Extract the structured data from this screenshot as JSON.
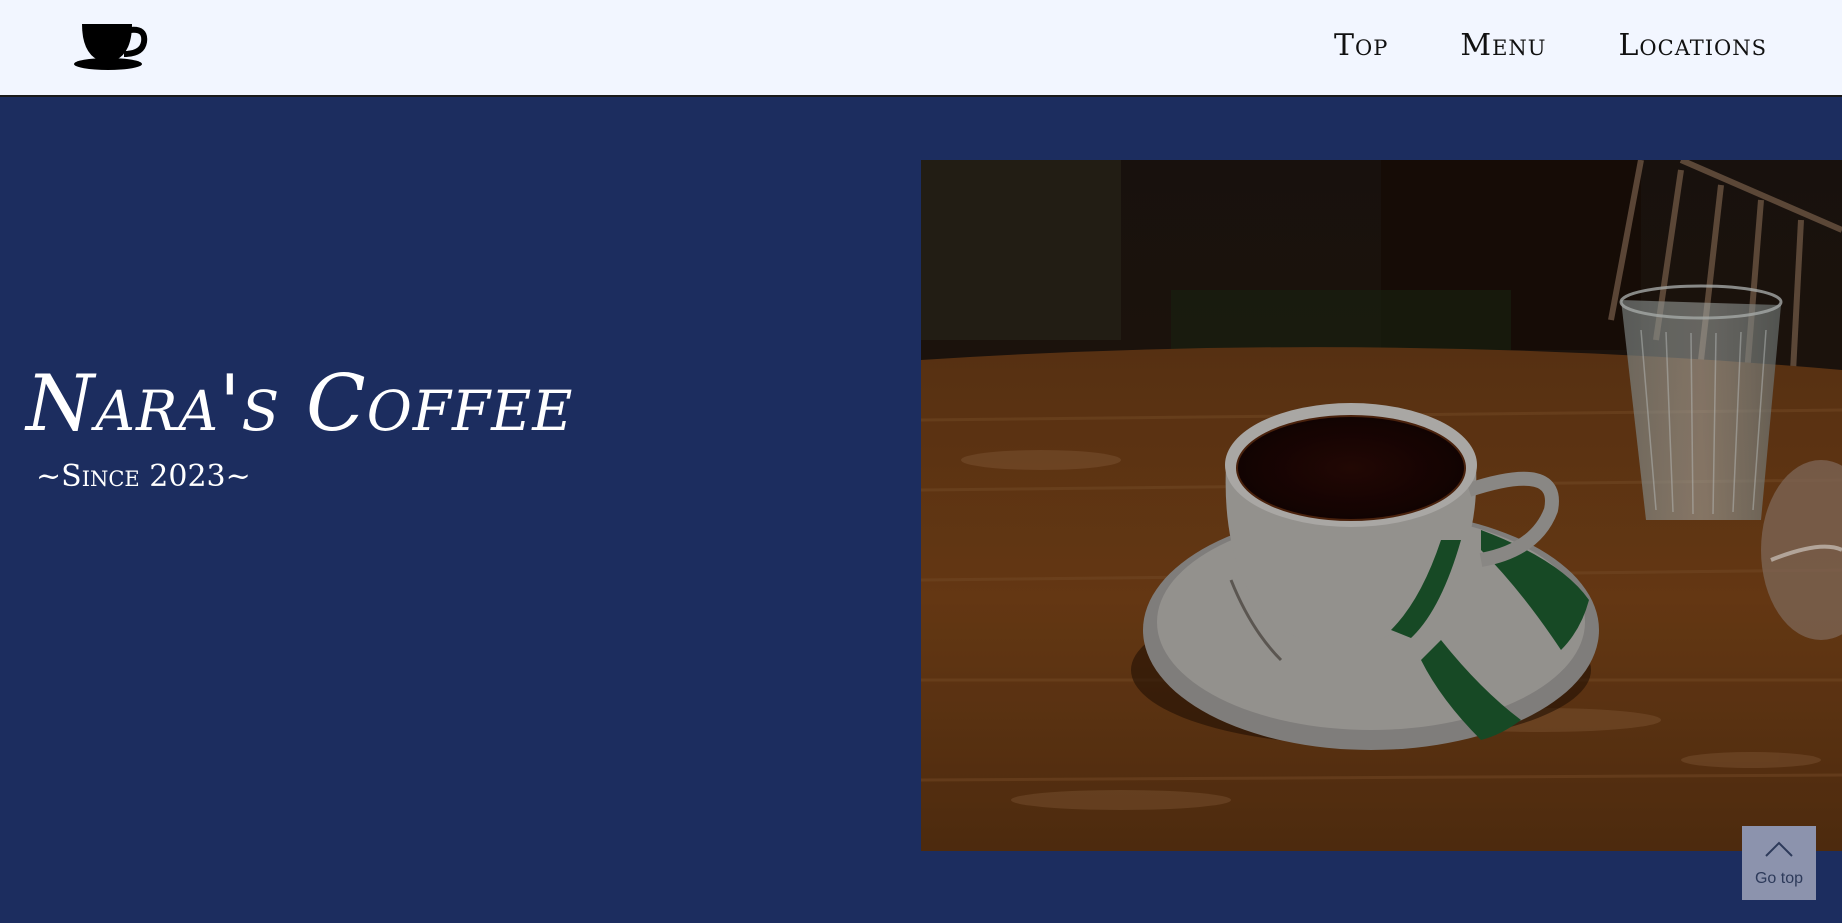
{
  "header": {
    "logo_icon": "coffee-cup-icon",
    "nav": [
      {
        "label": "Top"
      },
      {
        "label": "Menu"
      },
      {
        "label": "Locations"
      }
    ]
  },
  "hero": {
    "title": "Nara's Coffee",
    "subtitle": "~Since 2023~",
    "photo_subject": "coffee-cup-on-saucer-with-water-glass"
  },
  "go_top": {
    "label": "Go top",
    "icon": "chevron-up-icon"
  },
  "colors": {
    "header_bg": "#f2f6ff",
    "hero_bg": "#1c2d5f",
    "text_light": "#ffffff",
    "text_dark": "#111111",
    "go_top_bg": "#8c93ad"
  }
}
